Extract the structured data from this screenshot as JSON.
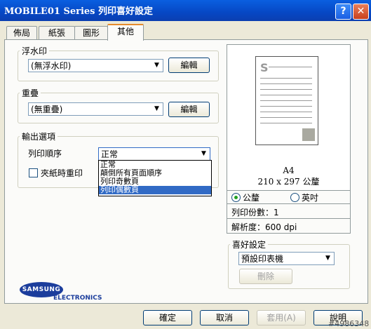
{
  "window": {
    "title": "MOBILE01 Series 列印喜好設定",
    "help_label": "?",
    "close_label": "✕"
  },
  "tabs": [
    {
      "label": "佈局"
    },
    {
      "label": "紙張"
    },
    {
      "label": "圖形"
    },
    {
      "label": "其他"
    }
  ],
  "watermark": {
    "group_label": "浮水印",
    "selected": "(無浮水印)",
    "edit_label": "編輯"
  },
  "overlay": {
    "group_label": "重疊",
    "selected": "(無重疊)",
    "edit_label": "編輯"
  },
  "output": {
    "group_label": "輸出選項",
    "print_order_label": "列印順序",
    "print_order_selected": "正常",
    "print_order_options": [
      "正常",
      "顛倒所有頁面順序",
      "列印奇數頁",
      "列印偶數頁"
    ],
    "highlighted_option_index": 3,
    "reprint_jam_label": "夾紙時重印",
    "reprint_jam_checked": false
  },
  "preview": {
    "paper_icon": "S",
    "paper_name": "A4",
    "paper_size": "210 x 297 公釐",
    "unit_mm_label": "公釐",
    "unit_in_label": "英吋",
    "unit_selected": "mm",
    "copies_text": "列印份數：1",
    "resolution_text": "解析度：600 dpi"
  },
  "favorites": {
    "group_label": "喜好設定",
    "selected": "預設印表機",
    "delete_label": "刪除"
  },
  "brand": {
    "name": "SAMSUNG",
    "sub": "ELECTRONICS"
  },
  "footer": {
    "ok_label": "確定",
    "cancel_label": "取消",
    "apply_label": "套用(A)",
    "help_label": "說明"
  },
  "watermark_id": "#4986348"
}
